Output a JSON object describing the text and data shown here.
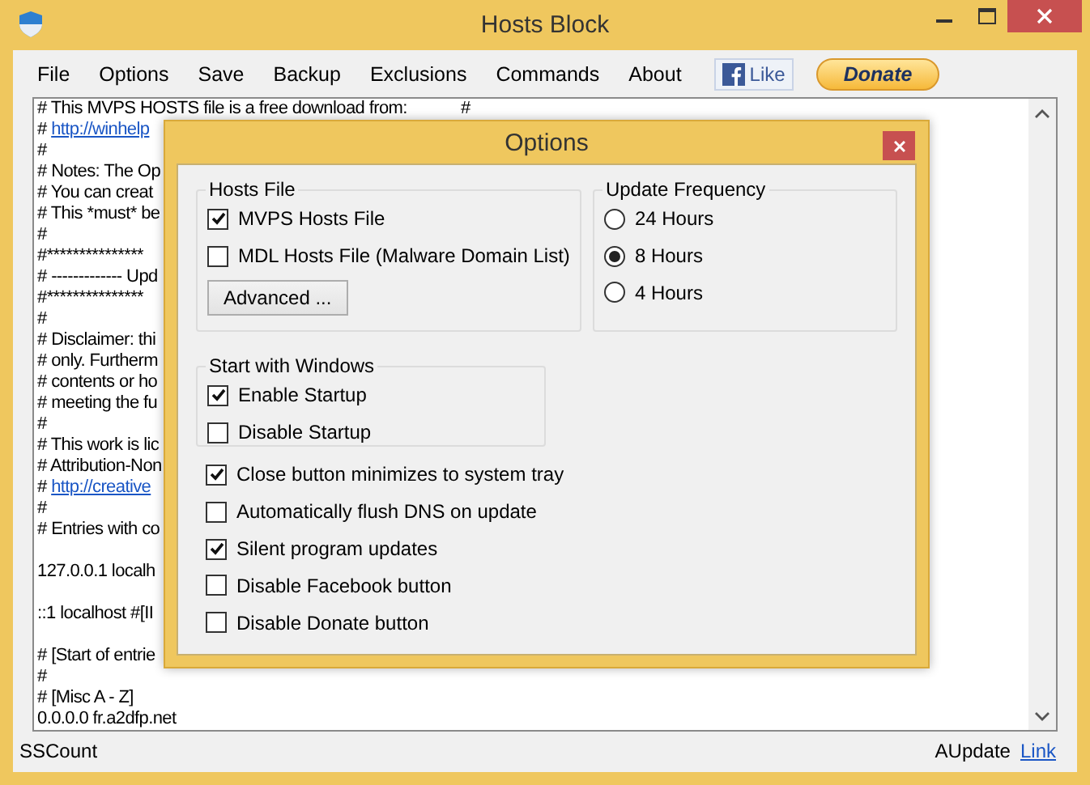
{
  "window": {
    "title": "Hosts Block"
  },
  "menu": [
    "File",
    "Options",
    "Save",
    "Backup",
    "Exclusions",
    "Commands",
    "About"
  ],
  "like_button": {
    "label": "Like"
  },
  "donate_button": {
    "label": "Donate"
  },
  "editor": {
    "lines": [
      {
        "kind": "text",
        "text": "# This MVPS HOSTS file is a free download from:            #"
      },
      {
        "kind": "link",
        "prefix": "# ",
        "text": "http://winhelp"
      },
      {
        "kind": "text",
        "text": "#"
      },
      {
        "kind": "text",
        "text": "# Notes: The Op"
      },
      {
        "kind": "text",
        "text": "# You can creat"
      },
      {
        "kind": "text",
        "text": "# This *must* be"
      },
      {
        "kind": "text",
        "text": "#"
      },
      {
        "kind": "text",
        "text": "#***************"
      },
      {
        "kind": "text",
        "text": "# ------------- Upd"
      },
      {
        "kind": "text",
        "text": "#***************"
      },
      {
        "kind": "text",
        "text": "#"
      },
      {
        "kind": "text",
        "text": "# Disclaimer: thi"
      },
      {
        "kind": "text",
        "text": "# only. Furtherm"
      },
      {
        "kind": "text",
        "text": "# contents or ho"
      },
      {
        "kind": "text",
        "text": "# meeting the fu"
      },
      {
        "kind": "text",
        "text": "#"
      },
      {
        "kind": "text",
        "text": "# This work is lic"
      },
      {
        "kind": "text",
        "text": "# Attribution-Non"
      },
      {
        "kind": "link",
        "prefix": "# ",
        "text": "http://creative"
      },
      {
        "kind": "text",
        "text": "#"
      },
      {
        "kind": "text",
        "text": "# Entries with co"
      },
      {
        "kind": "blank"
      },
      {
        "kind": "text",
        "text": "127.0.0.1 localh"
      },
      {
        "kind": "blank"
      },
      {
        "kind": "text",
        "text": "::1 localhost #[II"
      },
      {
        "kind": "blank"
      },
      {
        "kind": "text",
        "text": "# [Start of entrie"
      },
      {
        "kind": "text",
        "text": "#"
      },
      {
        "kind": "text",
        "text": "# [Misc A - Z]"
      },
      {
        "kind": "text",
        "text": "0.0.0.0 fr.a2dfp.net"
      }
    ]
  },
  "status_bar": {
    "left": "SSCount",
    "update": "AUpdate",
    "link": "Link"
  },
  "dialog": {
    "title": "Options",
    "hosts_file": {
      "title": "Hosts File",
      "options": [
        {
          "label": "MVPS Hosts File",
          "checked": true
        },
        {
          "label": "MDL Hosts File (Malware Domain List)",
          "checked": false
        }
      ],
      "button": "Advanced ..."
    },
    "update_frequency": {
      "title": "Update Frequency",
      "options": [
        {
          "label": "24 Hours",
          "selected": false
        },
        {
          "label": "8 Hours",
          "selected": true
        },
        {
          "label": "4 Hours",
          "selected": false
        }
      ]
    },
    "startup": {
      "title": "Start with Windows",
      "options": [
        {
          "label": "Enable Startup",
          "checked": true
        },
        {
          "label": "Disable Startup",
          "checked": false
        }
      ]
    },
    "options": [
      {
        "label": "Close button minimizes to system tray",
        "checked": true
      },
      {
        "label": "Automatically flush DNS on update",
        "checked": false
      },
      {
        "label": "Silent program updates",
        "checked": true
      },
      {
        "label": "Disable Facebook button",
        "checked": false
      },
      {
        "label": "Disable Donate button",
        "checked": false
      }
    ]
  }
}
